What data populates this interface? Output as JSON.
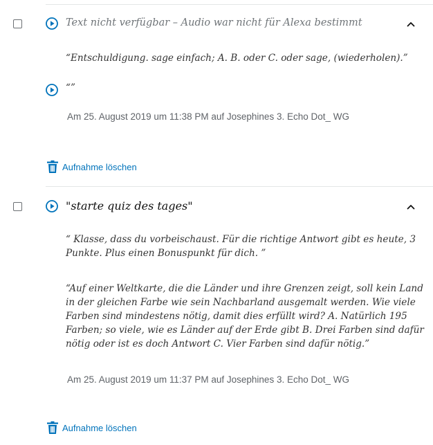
{
  "colors": {
    "accent": "#0073bb",
    "divider": "#e3e6e6",
    "timestamp": "#5f6368"
  },
  "entries": [
    {
      "title": "Text nicht verfügbar – Audio war nicht für Alexa bestimmt",
      "responses": [
        "“Entschuldigung. sage einfach; A. B. oder C. oder sage, (wiederholen).”"
      ],
      "secondary_audio_text": "“”",
      "timestamp": "Am 25. August 2019 um 11:38 PM auf Josephines 3. Echo Dot_ WG",
      "delete_label": "Aufnahme löschen",
      "play_icon": "play-circle-icon",
      "expand_icon": "chevron-up-icon",
      "delete_icon": "trash-icon"
    },
    {
      "title": "\"starte quiz des tages\"",
      "responses": [
        "“ Klasse, dass du vorbeischaust. Für die richtige Antwort gibt es heute, 3 Punkte. Plus einen Bonuspunkt für dich. ”",
        "“Auf einer Weltkarte, die die Länder und ihre Grenzen zeigt, soll kein Land in der gleichen Farbe wie sein Nachbarland ausgemalt werden. Wie viele Farben sind mindestens nötig, damit dies erfüllt wird? A. Natürlich 195 Farben; so viele, wie es Länder auf der Erde gibt B. Drei Farben sind dafür nötig oder ist es doch Antwort C. Vier Farben sind dafür nötig.”"
      ],
      "timestamp": "Am 25. August 2019 um 11:37 PM auf Josephines 3. Echo Dot_ WG",
      "delete_label": "Aufnahme löschen",
      "play_icon": "play-circle-icon",
      "expand_icon": "chevron-up-icon",
      "delete_icon": "trash-icon"
    }
  ]
}
